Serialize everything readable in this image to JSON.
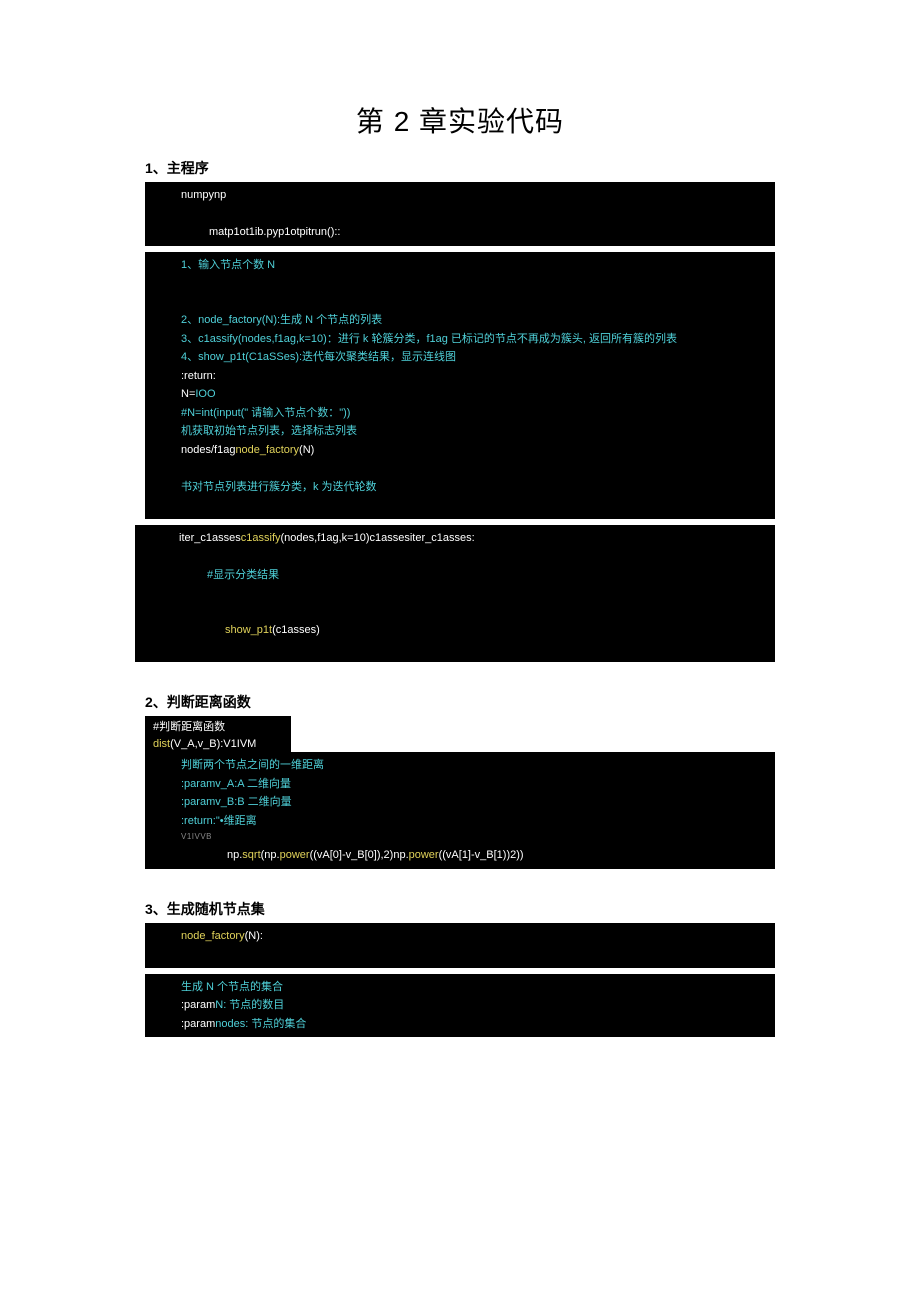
{
  "page_title": "第 2 章实验代码",
  "sections": {
    "s1_heading": "1、主程序",
    "s1": {
      "l00": "numpynp",
      "l01": "matp1ot1ib.pyp1otpitrun()::",
      "l02": "1、输入节点个数 N",
      "l03": "2、node_factory(N):生成 N 个节点的列表",
      "l04": "3、c1assify(nodes,f1ag,k=10)：进行 k 轮簇分类，f1ag 已标记的节点不再成为簇头, 返回所有簇的列表",
      "l05": "4、show_p1t(C1aSSes):迭代每次聚类结果，显示连线图",
      "l06": ":return:",
      "l07_a": "N=",
      "l07_b": "IOO",
      "l08": "#N=int(input(\" 请输入节点个数：\"))",
      "l09": "机获取初始节点列表，选择标志列表",
      "l10_a": "nodes/f1ag",
      "l10_b": "node_factory",
      "l10_c": "(N)",
      "l11": "书对节点列表进行簇分类，k 为迭代轮数",
      "l12_a": "iter_c1asses",
      "l12_b": "c1assify",
      "l12_c": "(nodes,f1ag,k=10)c1assesiter_c1asses:",
      "l13": "#显示分类结果",
      "l14_a": "show_p1t",
      "l14_b": "(c1asses)"
    },
    "s2_heading": "2、判断距离函数",
    "s2": {
      "l00": "#判断距离函数",
      "l01_a": "dist",
      "l01_b": "(V_A,v_B):V1IVM",
      "l02": "判断两个节点之间的一维距离",
      "l03": ":paramv_A:A 二维向量",
      "l04": ":paramv_B:B 二维向量",
      "l05": ":return:\"•维距离",
      "l06": "V1IVVB",
      "l07_a": "np.",
      "l07_b": "sqrt",
      "l07_c": "(np.",
      "l07_d": "power",
      "l07_e": "((vA[0]-v_B[0]),2)",
      "l07_f": "np.",
      "l07_g": "power",
      "l07_h": "((vA[1]-v_B[1))2))"
    },
    "s3_heading": "3、生成随机节点集",
    "s3": {
      "l00_a": "node_factory",
      "l00_b": "(N):",
      "l01": "生成 N 个节点的集合",
      "l02_a": ":param",
      "l02_b": "N: 节点的数目",
      "l03_a": ":param",
      "l03_b": "nodes: 节点的集合"
    }
  }
}
